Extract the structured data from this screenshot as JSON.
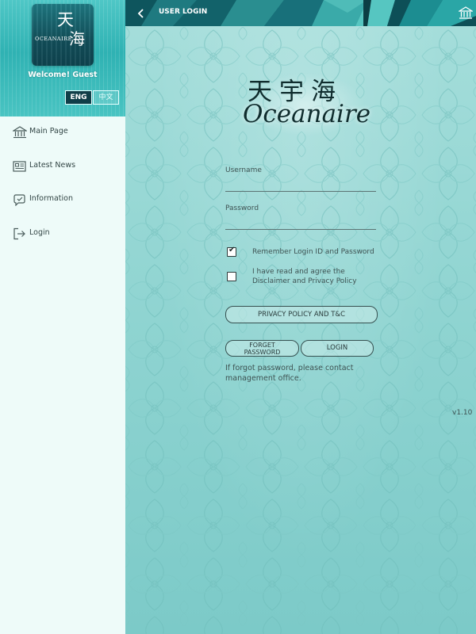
{
  "sidebar": {
    "logo": {
      "cn_top": "天",
      "cn_bottom": "海",
      "en": "OCEANAIRE"
    },
    "welcome": "Welcome! Guest",
    "lang": {
      "eng": "ENG",
      "cn": "中文",
      "selected": "ENG"
    },
    "items": [
      {
        "label": "Main Page",
        "icon": "bank-icon"
      },
      {
        "label": "Latest News",
        "icon": "newspaper-icon"
      },
      {
        "label": "Information",
        "icon": "info-icon"
      },
      {
        "label": "Login",
        "icon": "login-icon"
      }
    ]
  },
  "header": {
    "title": "USER LOGIN"
  },
  "brand": {
    "cn": "天宇海",
    "en": "Oceanaire"
  },
  "form": {
    "username_label": "Username",
    "username_value": "",
    "password_label": "Password",
    "password_value": "",
    "remember_label": "Remember Login ID and Password",
    "remember_checked": true,
    "agree_line1": "I have read and agree the",
    "agree_line2": "Disclaimer and Privacy Policy",
    "agree_checked": false,
    "privacy_button": "PRIVACY POLICY AND T&C",
    "forget_line1": "FORGET",
    "forget_line2": "PASSWORD",
    "login_button": "LOGIN",
    "note": "If forgot password, please contact management office."
  },
  "version": "v1.10",
  "colors": {
    "sidebar_header": "#2fb2b3",
    "topbar": "#145f67",
    "main_bg": "#8fd4d1",
    "lang_selected": "#0f3e48"
  }
}
